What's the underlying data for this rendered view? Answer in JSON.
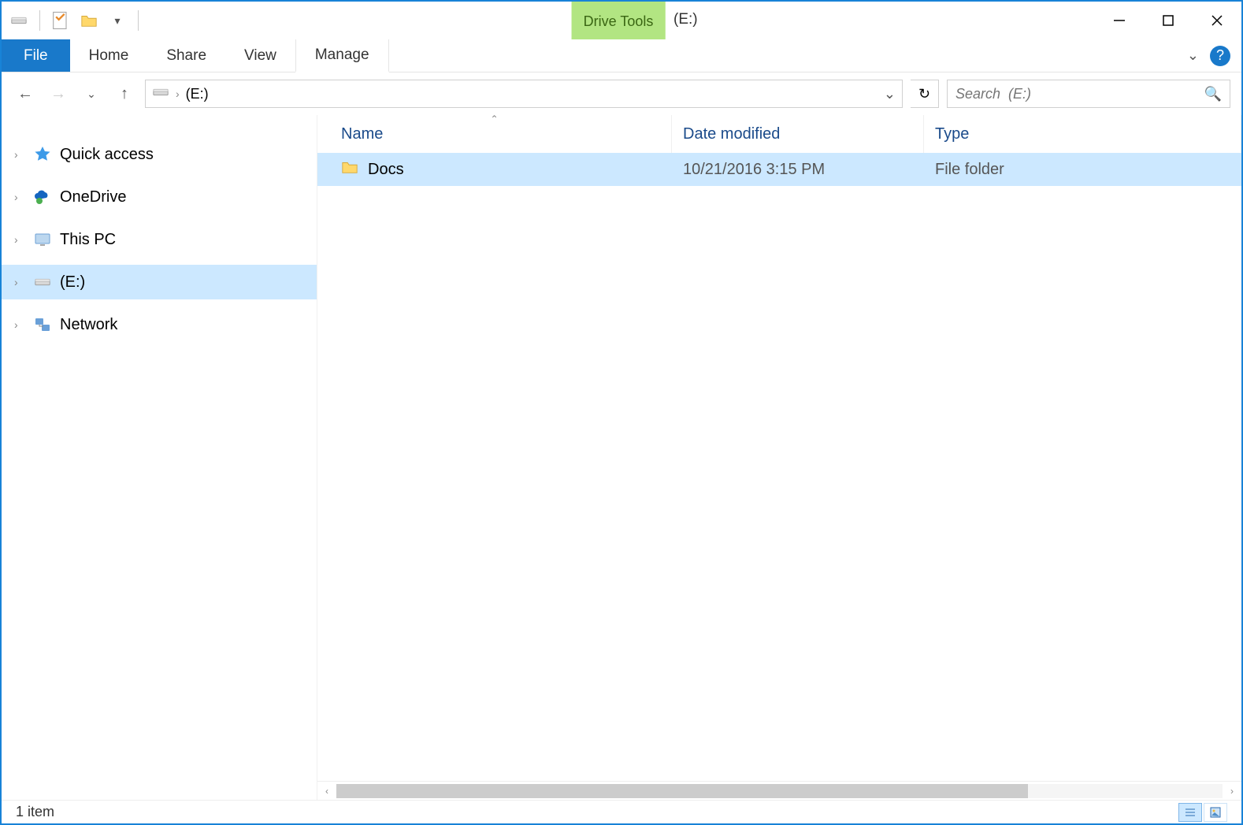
{
  "title": "(E:)",
  "contextual_tab_group": "Drive Tools",
  "ribbon": {
    "file": "File",
    "home": "Home",
    "share": "Share",
    "view": "View",
    "manage": "Manage"
  },
  "address": {
    "location": "(E:)"
  },
  "search": {
    "placeholder": "Search  (E:)"
  },
  "navpane": {
    "quick_access": "Quick access",
    "onedrive": "OneDrive",
    "this_pc": "This PC",
    "drive_e": "(E:)",
    "network": "Network"
  },
  "columns": {
    "name": "Name",
    "date": "Date modified",
    "type": "Type"
  },
  "items": [
    {
      "name": "Docs",
      "date": "10/21/2016 3:15 PM",
      "type": "File folder"
    }
  ],
  "status": {
    "item_count": "1 item"
  }
}
